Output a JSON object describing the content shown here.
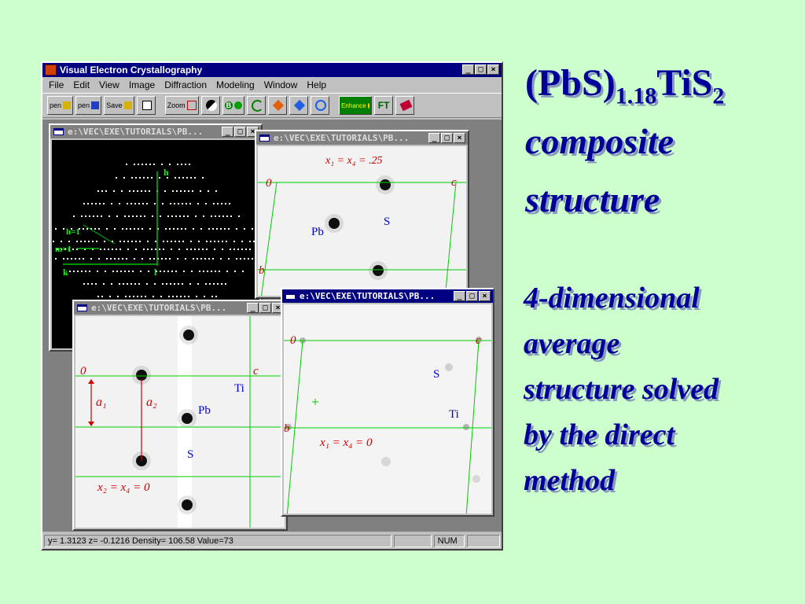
{
  "app": {
    "title": "Visual Electron Crystallography",
    "menu": [
      "File",
      "Edit",
      "View",
      "Image",
      "Diffraction",
      "Modeling",
      "Window",
      "Help"
    ],
    "toolbar": [
      {
        "label": "pen",
        "icon": "open-icon"
      },
      {
        "label": "pen",
        "icon": "open-image-icon"
      },
      {
        "label": "Save",
        "icon": "save-icon"
      },
      {
        "label": "",
        "icon": "print-icon"
      },
      {
        "label": "Zoom",
        "icon": "zoom-icon"
      },
      {
        "label": "",
        "icon": "contrast-icon"
      },
      {
        "label": "B",
        "icon": "blur-icon"
      },
      {
        "label": "",
        "icon": "rotate-icon"
      },
      {
        "label": "",
        "icon": "symmetry-icon"
      },
      {
        "label": "",
        "icon": "diffraction-icon"
      },
      {
        "label": "",
        "icon": "waves-icon"
      },
      {
        "label": "Enhance",
        "icon": "enhance-icon"
      },
      {
        "label": "FT",
        "icon": "fourier-icon"
      },
      {
        "label": "",
        "icon": "book-icon"
      }
    ],
    "status": {
      "coords": "y= 1.3123  z= -0.1216  Density= 106.58  Value=73",
      "num": "NUM"
    },
    "window_buttons": {
      "min": "_",
      "max": "□",
      "close": "×"
    }
  },
  "windows": {
    "diffraction": {
      "title": "e:\\VEC\\EXE\\TUTORIALS\\PB...",
      "labels": {
        "h": "h",
        "h1": "h=1",
        "m1": "m=1",
        "k": "k",
        "l": "l"
      }
    },
    "map1": {
      "title": "e:\\VEC\\EXE\\TUTORIALS\\PB...",
      "labels": {
        "formula": "x₁ = x₄ = .25",
        "o": "0",
        "c": "c",
        "b": "b",
        "pb": "Pb",
        "s": "S"
      }
    },
    "map2": {
      "title": "e:\\VEC\\EXE\\TUTORIALS\\PB...",
      "labels": {
        "o": "0",
        "c": "c",
        "a1": "a₁",
        "a2": "a₂",
        "ti": "Ti",
        "pb": "Pb",
        "s": "S",
        "formula": "x₂ = x₄ = 0"
      }
    },
    "map3": {
      "title": "e:\\VEC\\EXE\\TUTORIALS\\PB...",
      "labels": {
        "o": "0",
        "c": "c",
        "b": "b",
        "s": "S",
        "ti": "Ti",
        "formula": "x₁ = x₄ = 0"
      }
    }
  },
  "slide": {
    "heading_main": "(PbS)",
    "heading_sub": "1.18",
    "heading_main2": "TiS",
    "heading_sub2": "2",
    "line2": "composite",
    "line3": "structure",
    "body": [
      "4-dimensional",
      "average",
      "structure solved",
      "by the direct",
      "method"
    ]
  },
  "colors": {
    "background": "#ccffcc",
    "slide_text": "#000099",
    "titlebar": "#000080",
    "grid": "#00cc00",
    "annotation_red": "#cc0000",
    "annotation_blue": "#0000cc"
  }
}
